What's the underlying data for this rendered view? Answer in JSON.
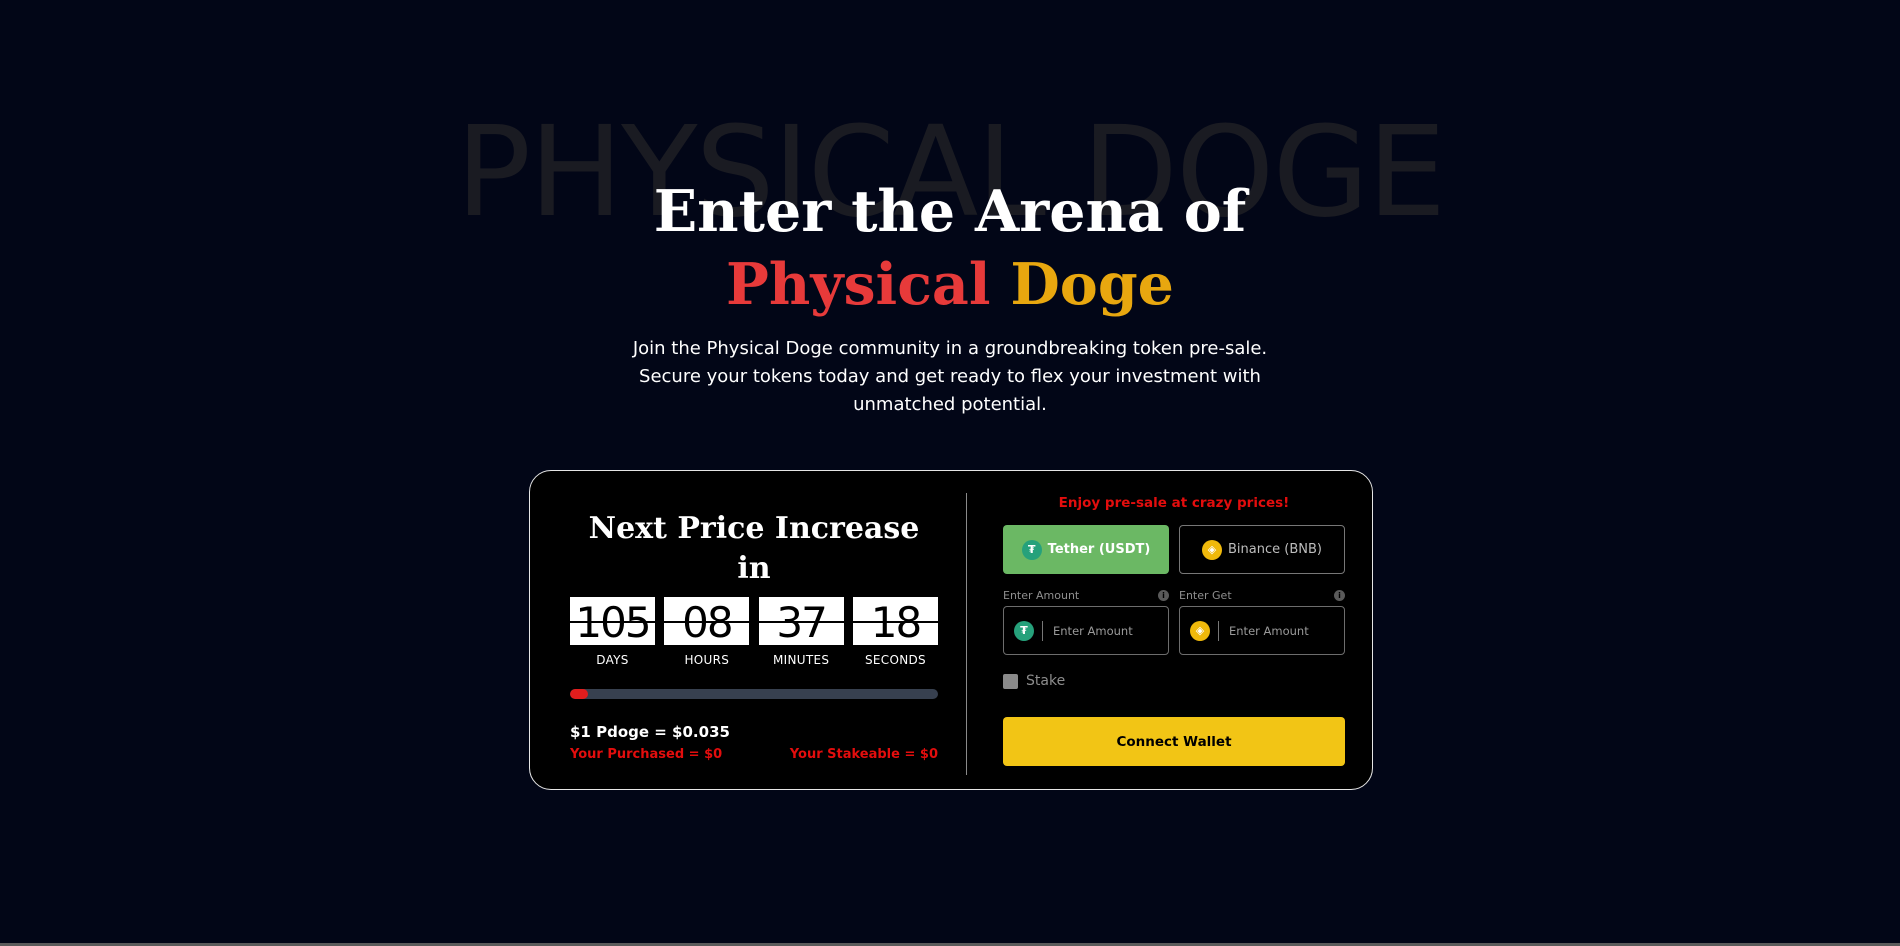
{
  "hero": {
    "watermark": "PHYSICAL DOGE",
    "title_line1": "Enter the Arena of",
    "title_red": "Physical",
    "title_gold": "Doge",
    "subtitle": "Join the Physical Doge community in a groundbreaking token pre-sale. Secure your tokens today and get ready to flex your investment with unmatched potential."
  },
  "countdown": {
    "title": "Next Price Increase in",
    "units": [
      {
        "value": "105",
        "label": "DAYS"
      },
      {
        "value": "08",
        "label": "HOURS"
      },
      {
        "value": "37",
        "label": "MINUTES"
      },
      {
        "value": "18",
        "label": "SECONDS"
      }
    ],
    "progress_fraction": 0.05
  },
  "pricing": {
    "rate": "$1 Pdoge = $0.035",
    "purchased": "Your Purchased = $0",
    "stakeable": "Your Stakeable = $0"
  },
  "purchase": {
    "promo": "Enjoy pre-sale at crazy prices!",
    "currencies": [
      {
        "label": "Tether (USDT)",
        "icon": "tether-icon",
        "active": true
      },
      {
        "label": "Binance (BNB)",
        "icon": "bnb-icon",
        "active": false
      }
    ],
    "amount_label": "Enter Amount",
    "get_label": "Enter Get",
    "amount_placeholder": "Enter Amount",
    "get_placeholder": "Enter Amount",
    "stake_label": "Stake",
    "connect_label": "Connect Wallet"
  },
  "colors": {
    "background": "#020617",
    "accent_red": "#e73a3a",
    "accent_gold": "#e8a70f",
    "active_green": "#6bb864",
    "cta_yellow": "#f2c515",
    "alert_red": "#e30d0d"
  }
}
